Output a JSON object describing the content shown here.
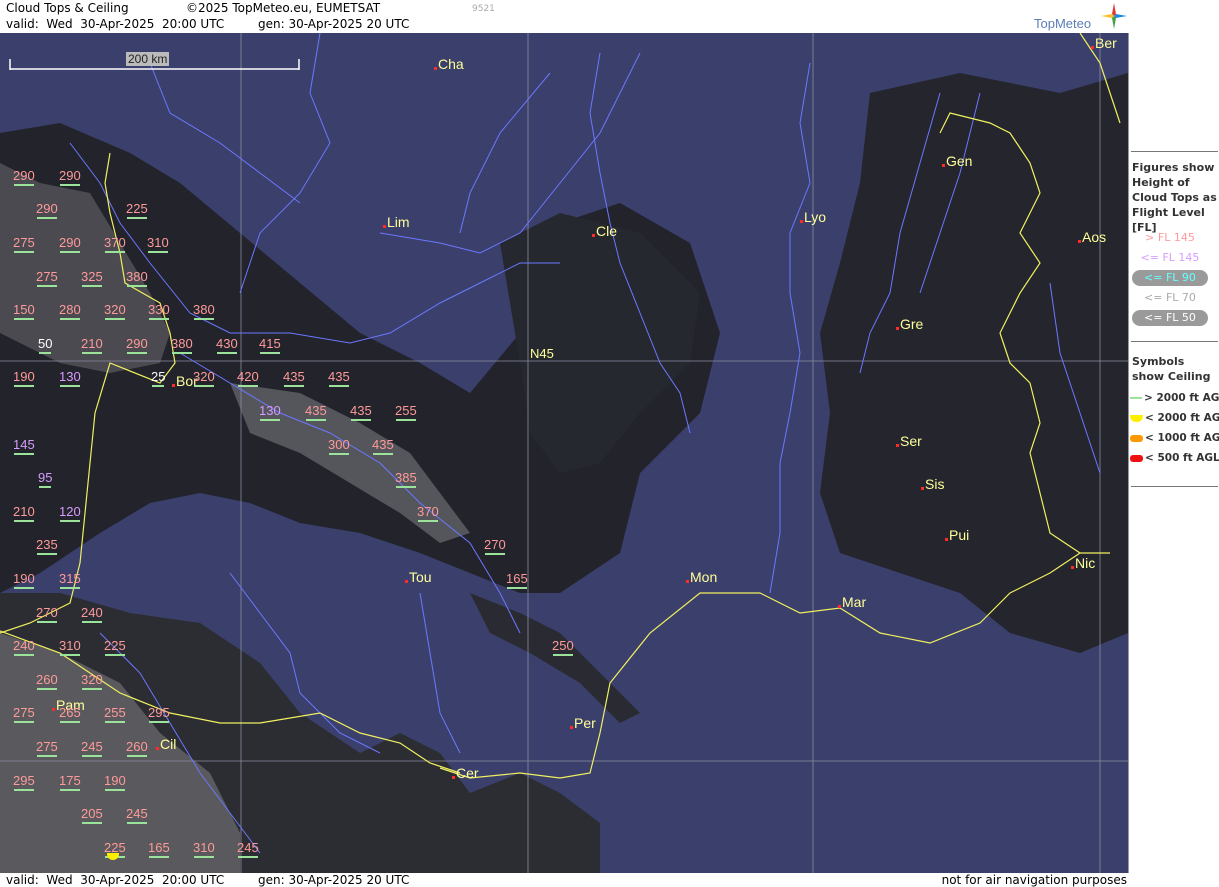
{
  "header": {
    "title": "Cloud Tops & Ceiling",
    "copyright": "©2025 TopMeteo.eu, EUMETSAT",
    "image_code": "9521",
    "valid": "valid:  Wed  30-Apr-2025  20:00 UTC",
    "generated": "gen: 30-Apr-2025 20 UTC",
    "logo": "TopMeteo"
  },
  "scale": {
    "label": "200 km"
  },
  "gridline_label": "N45",
  "cities": [
    {
      "name": "Cha"
    },
    {
      "name": "Ber"
    },
    {
      "name": "Gen"
    },
    {
      "name": "Lim"
    },
    {
      "name": "Cle"
    },
    {
      "name": "Lyo"
    },
    {
      "name": "Aos"
    },
    {
      "name": "Gre"
    },
    {
      "name": "Bor"
    },
    {
      "name": "Ser"
    },
    {
      "name": "Sis"
    },
    {
      "name": "Pui"
    },
    {
      "name": "Tou"
    },
    {
      "name": "Mon"
    },
    {
      "name": "Nic"
    },
    {
      "name": "Mar"
    },
    {
      "name": "Pam"
    },
    {
      "name": "Per"
    },
    {
      "name": "Cil"
    },
    {
      "name": "Cer"
    }
  ],
  "flight_levels": [
    {
      "v": "290",
      "c": "high"
    },
    {
      "v": "290",
      "c": "high"
    },
    {
      "v": "290",
      "c": "high"
    },
    {
      "v": "225",
      "c": "high"
    },
    {
      "v": "275",
      "c": "high"
    },
    {
      "v": "290",
      "c": "high"
    },
    {
      "v": "370",
      "c": "high"
    },
    {
      "v": "310",
      "c": "high"
    },
    {
      "v": "275",
      "c": "high"
    },
    {
      "v": "325",
      "c": "high"
    },
    {
      "v": "380",
      "c": "high"
    },
    {
      "v": "150",
      "c": "high"
    },
    {
      "v": "280",
      "c": "high"
    },
    {
      "v": "320",
      "c": "high"
    },
    {
      "v": "330",
      "c": "high"
    },
    {
      "v": "380",
      "c": "high"
    },
    {
      "v": "50",
      "c": "white"
    },
    {
      "v": "210",
      "c": "high"
    },
    {
      "v": "290",
      "c": "high"
    },
    {
      "v": "380",
      "c": "high"
    },
    {
      "v": "430",
      "c": "high"
    },
    {
      "v": "415",
      "c": "high"
    },
    {
      "v": "190",
      "c": "high"
    },
    {
      "v": "130",
      "c": "low"
    },
    {
      "v": "25",
      "c": "white"
    },
    {
      "v": "320",
      "c": "high"
    },
    {
      "v": "420",
      "c": "high"
    },
    {
      "v": "435",
      "c": "high"
    },
    {
      "v": "435",
      "c": "high"
    },
    {
      "v": "130",
      "c": "low"
    },
    {
      "v": "435",
      "c": "high"
    },
    {
      "v": "435",
      "c": "high"
    },
    {
      "v": "255",
      "c": "high"
    },
    {
      "v": "145",
      "c": "low"
    },
    {
      "v": "300",
      "c": "high"
    },
    {
      "v": "435",
      "c": "high"
    },
    {
      "v": "95",
      "c": "low"
    },
    {
      "v": "385",
      "c": "high"
    },
    {
      "v": "210",
      "c": "high"
    },
    {
      "v": "120",
      "c": "low"
    },
    {
      "v": "370",
      "c": "high"
    },
    {
      "v": "235",
      "c": "high"
    },
    {
      "v": "270",
      "c": "high"
    },
    {
      "v": "190",
      "c": "high"
    },
    {
      "v": "315",
      "c": "high"
    },
    {
      "v": "165",
      "c": "high"
    },
    {
      "v": "270",
      "c": "high"
    },
    {
      "v": "240",
      "c": "high"
    },
    {
      "v": "240",
      "c": "high"
    },
    {
      "v": "310",
      "c": "high"
    },
    {
      "v": "225",
      "c": "high"
    },
    {
      "v": "250",
      "c": "high"
    },
    {
      "v": "260",
      "c": "high"
    },
    {
      "v": "320",
      "c": "high"
    },
    {
      "v": "275",
      "c": "high"
    },
    {
      "v": "265",
      "c": "high"
    },
    {
      "v": "255",
      "c": "high"
    },
    {
      "v": "295",
      "c": "high"
    },
    {
      "v": "275",
      "c": "high"
    },
    {
      "v": "245",
      "c": "high"
    },
    {
      "v": "260",
      "c": "high"
    },
    {
      "v": "295",
      "c": "high"
    },
    {
      "v": "175",
      "c": "high"
    },
    {
      "v": "190",
      "c": "high"
    },
    {
      "v": "205",
      "c": "high"
    },
    {
      "v": "245",
      "c": "high"
    },
    {
      "v": "225",
      "c": "high"
    },
    {
      "v": "165",
      "c": "high"
    },
    {
      "v": "310",
      "c": "high"
    },
    {
      "v": "245",
      "c": "high"
    }
  ],
  "legend": {
    "figures_text": "Figures show Height of Cloud Tops as Flight Level  [FL]",
    "levels": [
      {
        "label": "> FL 145",
        "color": "#ff9a9a"
      },
      {
        "label": "<= FL 145",
        "color": "#d79cff"
      },
      {
        "label": "<= FL 90",
        "color": "#66ffff"
      },
      {
        "label": "<= FL 70",
        "color": "#aaaaaa"
      },
      {
        "label": "<= FL 50",
        "color": "#ffffff"
      }
    ],
    "symbols_text": "Symbols show Ceiling",
    "symbols": [
      {
        "label": "> 2000 ft AGL",
        "color": "#9be39b"
      },
      {
        "label": "< 2000 ft AGL",
        "color": "#ffee00"
      },
      {
        "label": "< 1000 ft AGL",
        "color": "#ff9900"
      },
      {
        "label": "< 500 ft AGL",
        "color": "#ee1111"
      }
    ]
  },
  "footer": {
    "valid": "valid:  Wed  30-Apr-2025  20:00 UTC",
    "generated": "gen: 30-Apr-2025 20 UTC",
    "note": "not for air navigation purposes"
  }
}
